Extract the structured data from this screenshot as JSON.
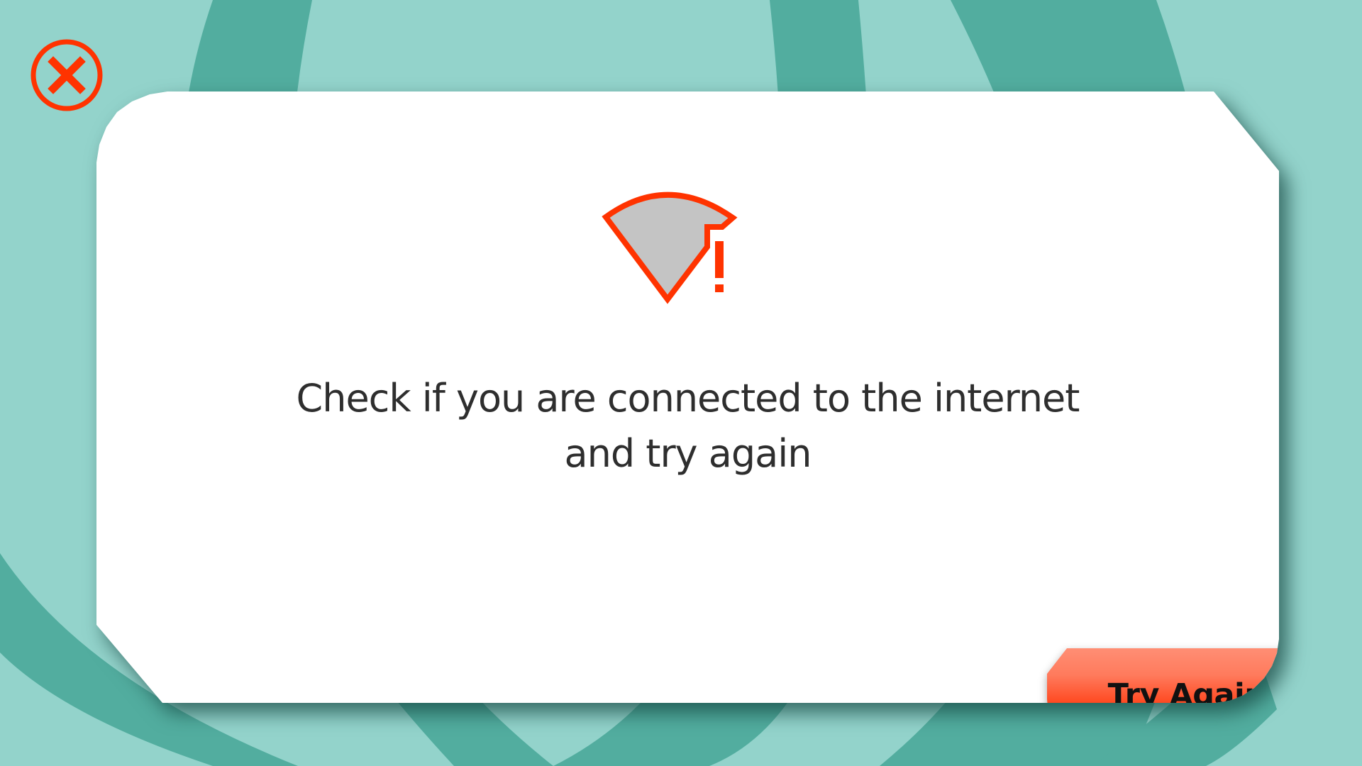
{
  "background": {
    "base_color": "#93d3cb",
    "ring_color": "#52ad9f"
  },
  "close_button": {
    "icon": "close-icon",
    "color": "#ff3300"
  },
  "dialog": {
    "icon": "wifi-warning-icon",
    "icon_fill": "#c4c4c4",
    "icon_stroke": "#ff3300",
    "message": "Check if you are connected to the internet and try again",
    "action_label": "Try Again",
    "action_color": "#ff3300"
  }
}
